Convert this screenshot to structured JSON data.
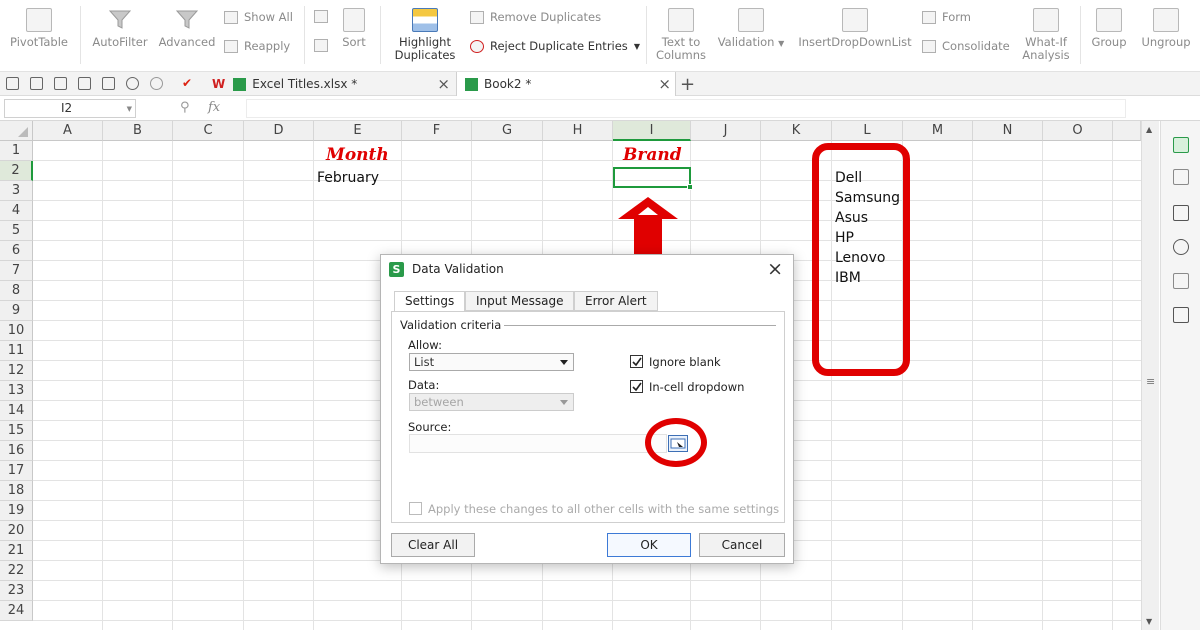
{
  "ribbon": {
    "pivot": "PivotTable",
    "autofilter": "AutoFilter",
    "advanced": "Advanced",
    "show_all": "Show All",
    "reapply": "Reapply",
    "sort": "Sort",
    "highlight_dup_1": "Highlight",
    "highlight_dup_2": "Duplicates",
    "remove_dup": "Remove Duplicates",
    "reject_dup": "Reject Duplicate Entries",
    "text_to_columns_1": "Text to",
    "text_to_columns_2": "Columns",
    "validation": "Validation",
    "insert_dropdown": "InsertDropDownList",
    "form": "Form",
    "consolidate": "Consolidate",
    "whatif_1": "What-If",
    "whatif_2": "Analysis",
    "group": "Group",
    "ungroup": "Ungroup"
  },
  "tabs": {
    "file1": "Excel Titles.xlsx *",
    "file2": "Book2 *",
    "add": "+",
    "close": "×"
  },
  "formula_bar": {
    "cell_ref": "I2",
    "fx": "fx",
    "value": ""
  },
  "sheet": {
    "columns": [
      "A",
      "B",
      "C",
      "D",
      "E",
      "F",
      "G",
      "H",
      "I",
      "J",
      "K",
      "L",
      "M",
      "N",
      "O"
    ],
    "rows": [
      "1",
      "2",
      "3",
      "4",
      "5",
      "6",
      "7",
      "8",
      "9",
      "10",
      "11",
      "12",
      "13",
      "14",
      "15",
      "16",
      "17",
      "18",
      "19",
      "20",
      "21",
      "22",
      "23",
      "24"
    ],
    "month_header": "Month",
    "month_value": "February",
    "brand_header": "Brand",
    "brands": [
      "Dell",
      "Samsung",
      "Asus",
      "HP",
      "Lenovo",
      "IBM"
    ]
  },
  "dialog": {
    "title": "Data Validation",
    "tabs": [
      "Settings",
      "Input Message",
      "Error Alert"
    ],
    "criteria": "Validation criteria",
    "allow_label": "Allow:",
    "allow_value": "List",
    "data_label": "Data:",
    "data_value": "between",
    "source_label": "Source:",
    "source_value": "",
    "ignore_blank": "Ignore blank",
    "ignore_blank_checked": true,
    "incell_dropdown": "In-cell dropdown",
    "incell_dropdown_checked": true,
    "apply_all": "Apply these changes to all other cells with the same settings",
    "apply_all_checked": false,
    "clear_all": "Clear All",
    "ok": "OK",
    "cancel": "Cancel",
    "close": "×"
  },
  "colors": {
    "annotation": "#e00000",
    "selection": "#1e9a3c",
    "ok_border": "#3d7ad6"
  }
}
